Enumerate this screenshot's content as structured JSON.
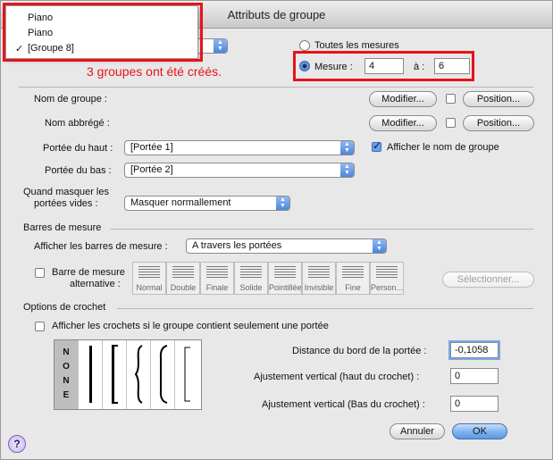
{
  "window": {
    "title": "Attributs de groupe"
  },
  "dropdown_menu": {
    "items": [
      "Piano",
      "Piano",
      "[Groupe 8]"
    ],
    "checked_index": 2
  },
  "annotation": {
    "text": "3 groupes ont été créés."
  },
  "range": {
    "all_label": "Toutes les mesures",
    "measure_label": "Mesure :",
    "from": "4",
    "to_label": "à :",
    "to": "6"
  },
  "group_name": {
    "label": "Nom de groupe :",
    "modify": "Modifier...",
    "position": "Position..."
  },
  "abbr_name": {
    "label": "Nom abbrégé :",
    "modify": "Modifier...",
    "position": "Position..."
  },
  "top_staff": {
    "label": "Portée du haut :",
    "value": "[Portée 1]"
  },
  "show_group_name": {
    "label": "Afficher le nom de groupe"
  },
  "bottom_staff": {
    "label": "Portée du bas :",
    "value": "[Portée 2]"
  },
  "hide_empty": {
    "label_line1": "Quand masquer les",
    "label_line2": "portées vides :",
    "value": "Masquer normallement"
  },
  "barlines": {
    "section": "Barres de mesure",
    "show_label": "Afficher les barres de mesure :",
    "show_value": "A travers les portées",
    "alt_label_line1": "Barre de mesure",
    "alt_label_line2": "alternative :",
    "styles": [
      "Normal",
      "Double",
      "Finale",
      "Solide",
      "Pointillée",
      "Invisible",
      "Fine",
      "Person..."
    ],
    "select": "Sélectionner..."
  },
  "brackets": {
    "section": "Options de crochet",
    "single_staff_label": "Afficher les crochets si le groupe contient seulement une portée",
    "none_letters": [
      "N",
      "O",
      "N",
      "E"
    ],
    "distance_label": "Distance du bord de la portée :",
    "distance_value": "-0,1058",
    "adj_top_label": "Ajustement vertical (haut du crochet) :",
    "adj_top_value": "0",
    "adj_bottom_label": "Ajustement vertical (Bas du crochet) :",
    "adj_bottom_value": "0"
  },
  "buttons": {
    "cancel": "Annuler",
    "ok": "OK",
    "help": "?"
  },
  "colors": {
    "annotation_red": "#e8121b",
    "accent_blue": "#5c98e6"
  }
}
